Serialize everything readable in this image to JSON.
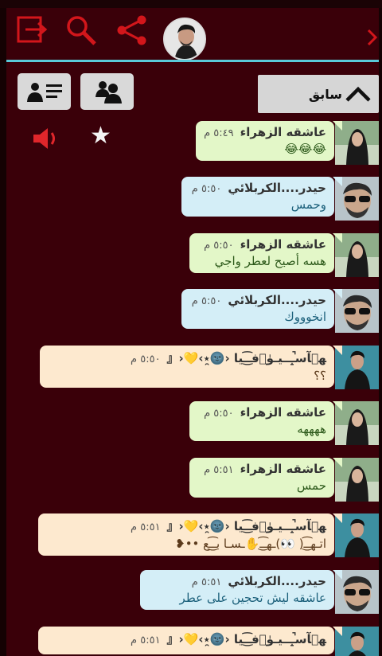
{
  "header": {
    "logout_icon": "logout-icon",
    "search_icon": "search-icon",
    "share_icon": "share-icon",
    "back_icon": "chevron-right-icon"
  },
  "toolbar": {
    "prev_label": "سابق",
    "members_icon": "users-icon",
    "list_icon": "user-list-icon",
    "speaker_icon": "speaker-icon",
    "star_icon": "star-icon"
  },
  "messages": [
    {
      "name": "عاشقه الزهراء",
      "time": "٥:٤٩ م",
      "text": "😂😂😂",
      "color": "green"
    },
    {
      "name": "حيدر....الكربلائي",
      "time": "٥:٥٠ م",
      "text": "وحمس",
      "color": "blue"
    },
    {
      "name": "عاشقه الزهراء",
      "time": "٥:٥٠ م",
      "text": "هسه أصيح لعطر واجي",
      "color": "green"
    },
    {
      "name": "حيدر....الكربلائي",
      "time": "٥:٥٠ م",
      "text": "انخوووك",
      "color": "blue"
    },
    {
      "name": "ﻬ۫ﺂﺳ̝̚ـــيـوٰ۫فـ͜͡ـيا ‹🌚̯٭›💛‹『",
      "time": "٥:٥٠ م",
      "text": "؟؟",
      "color": "peach"
    },
    {
      "name": "عاشقه الزهراء",
      "time": "٥:٥٠ م",
      "text": "ههههه",
      "color": "green"
    },
    {
      "name": "عاشقه الزهراء",
      "time": "٥:٥١ م",
      "text": "حمس",
      "color": "green"
    },
    {
      "name": "ﻬ۫ﺂﺳ̝̚ـــيـوٰ۫فـ͜͡ـيا ‹🌚̯٭›💛‹『",
      "time": "٥:٥١ م",
      "text": "اتـهـ͜͡ـ( 👀)ـهـ͜͡ـ✋ـسـا بـ͜͡ـع ••❥",
      "color": "peach"
    },
    {
      "name": "حيدر....الكربلائي",
      "time": "٥:٥١ م",
      "text": "عاشقه ليش تحجين على عطر",
      "color": "blue"
    },
    {
      "name": "ﻬ۫ﺂﺳ̝̚ـــيـوٰ۫فـ͜͡ـيا ‹🌚̯٭›💛‹『",
      "time": "٥:٥١ م",
      "text": "",
      "color": "peach"
    }
  ]
}
